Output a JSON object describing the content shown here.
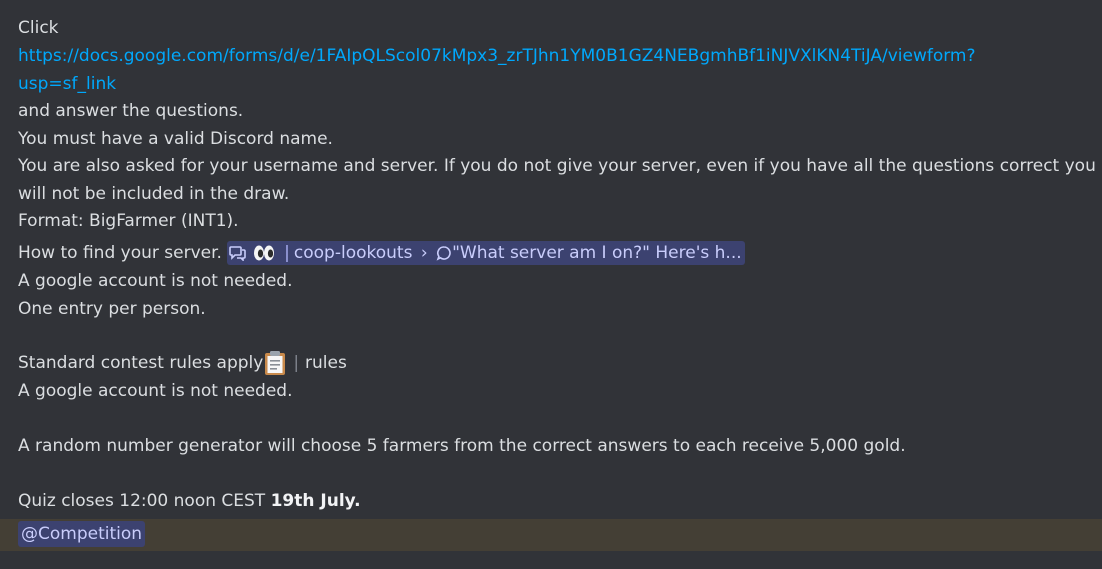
{
  "message": {
    "line1": "Click",
    "link_part1": "https://docs.google.com/forms/d/e/1FAIpQLScol07kMpx3_zrTJhn1YM0B1GZ4NEBgmhBf1iNJVXlKN4TiJA/viewform?",
    "link_part2": "usp=sf_link",
    "line3": "and answer the questions.",
    "line4": "You must have a valid Discord name.",
    "line5a": "You are also asked for your username and server. If you do not give your server, even if you have all the questions correct you",
    "line5b": "will not be included in the draw.",
    "line6": "Format: BigFarmer (INT1).",
    "line7": "How to find your server.",
    "channel_name": "coop-lookouts",
    "thread_name": "\"What server am I on?\" Here's h...",
    "line8": "A google account is not needed.",
    "line9": "One entry per person.",
    "line10a": "Standard contest rules  apply",
    "rules_channel": "rules",
    "line11": "A google account is not needed.",
    "line12": " A random number generator will choose 5 farmers from the correct answers to each receive 5,000 gold.",
    "line13a": "Quiz closes 12:00 noon CEST ",
    "line13b": "19th July.",
    "role_mention": "@Competition"
  },
  "colors": {
    "background": "#313338",
    "text": "#dbdee1",
    "link": "#00a8fc",
    "mention_bg": "#3c4270",
    "mention_text": "#c9cdfb",
    "highlight_row": "#443f35"
  },
  "icons": {
    "thread_icon": "threads-icon",
    "eyes_emoji": "eyes-emoji-icon",
    "clipboard_emoji": "clipboard-emoji-icon",
    "chat_bubble": "thread-bubble-icon"
  }
}
